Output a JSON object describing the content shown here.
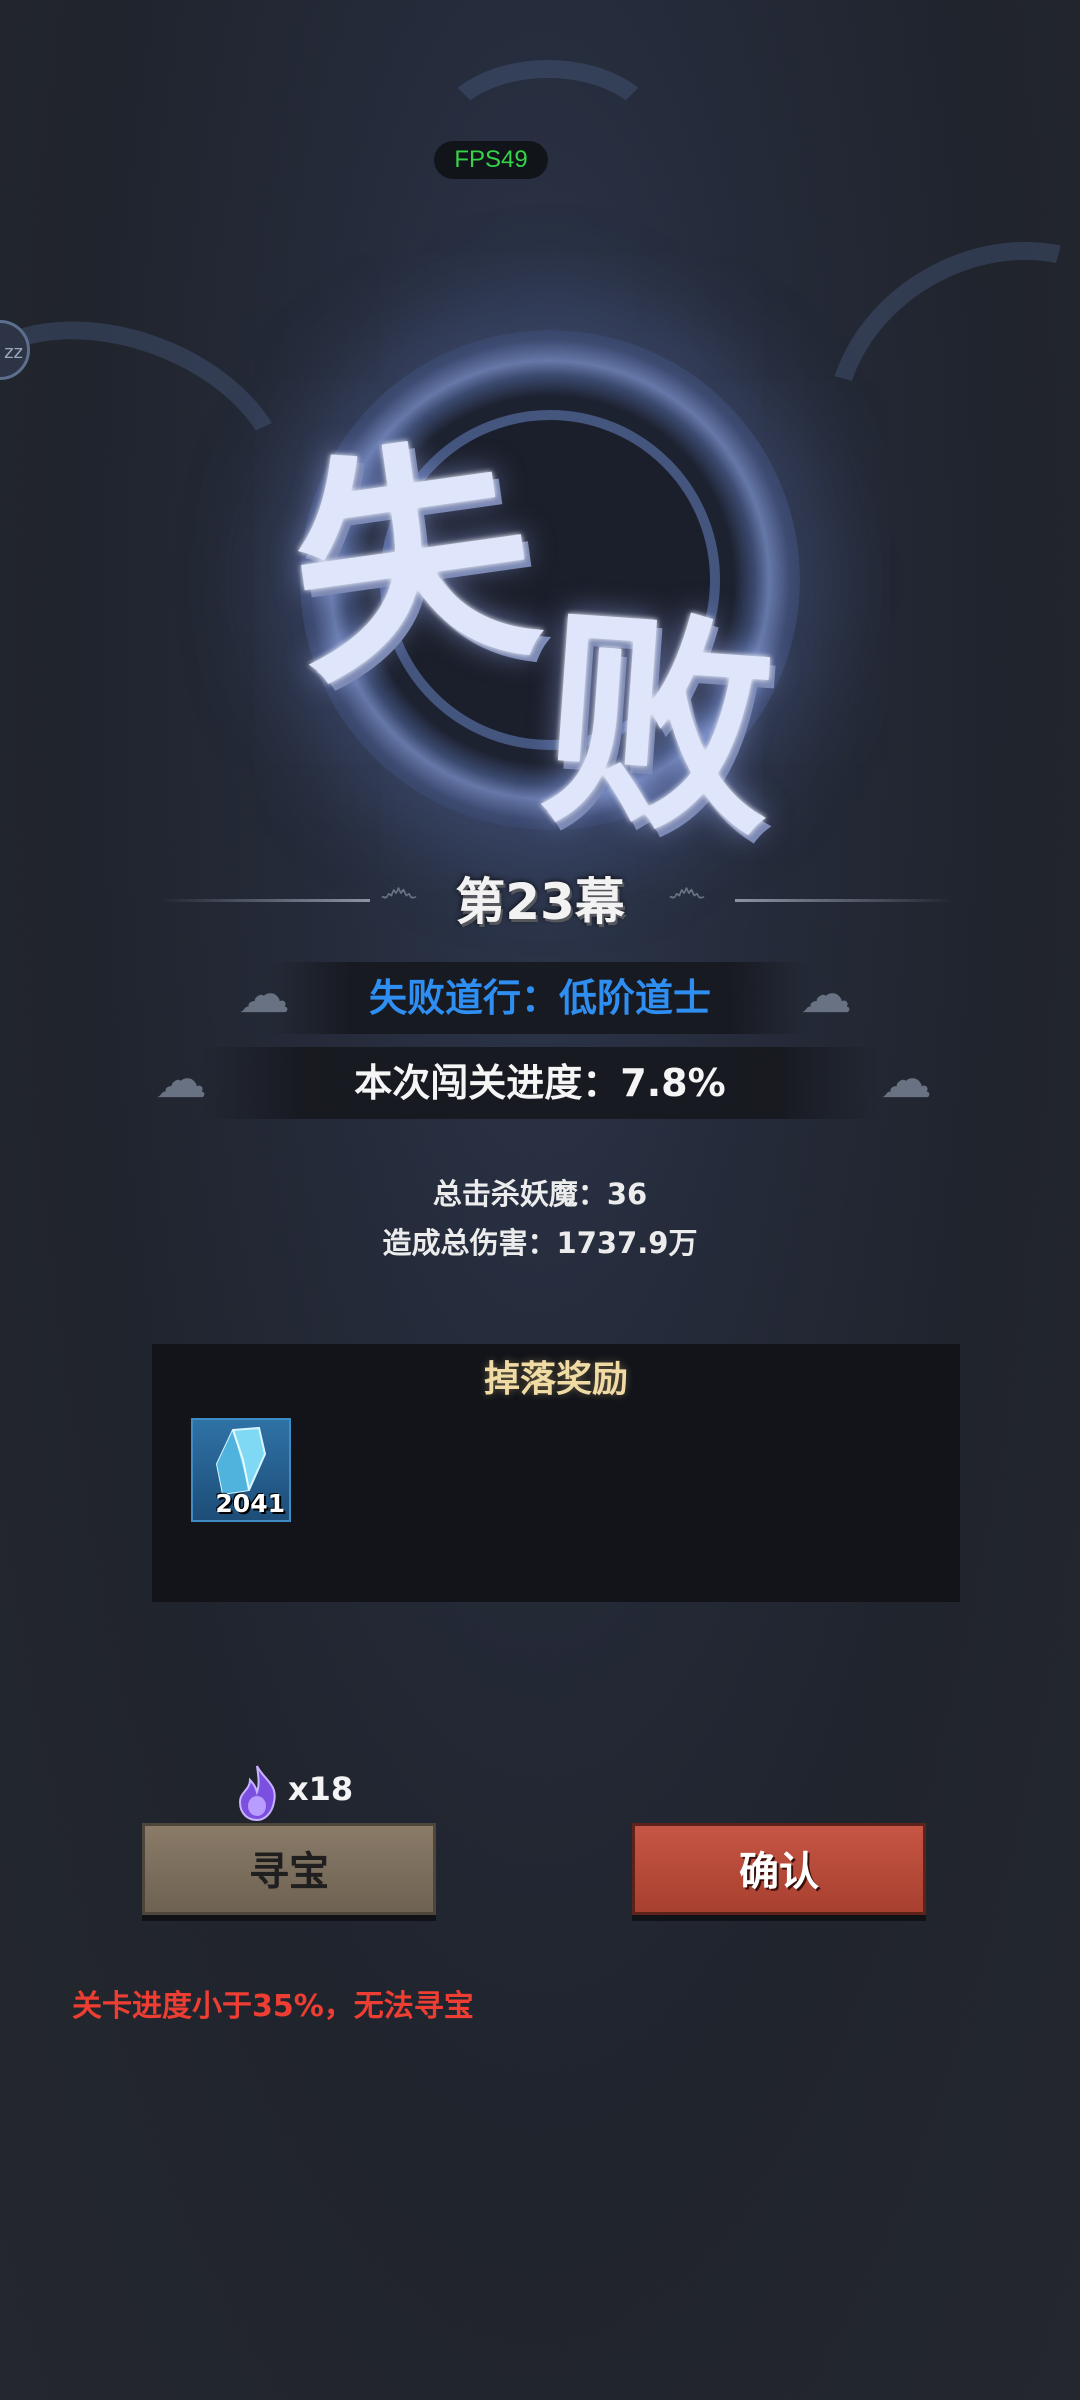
{
  "hud": {
    "fps": "FPS49",
    "side_badge": "zz"
  },
  "result": {
    "title_char1": "失",
    "title_char2": "败",
    "stage": "第23幕"
  },
  "summary": {
    "fail_rank": "失败道行：低阶道士",
    "progress": "本次闯关进度：7.8%",
    "kills": "总击杀妖魔：36",
    "damage": "造成总伤害：1737.9万"
  },
  "rewards": {
    "title": "掉落奖励",
    "items": [
      {
        "icon": "blue-crystal-icon",
        "count": "2041"
      }
    ]
  },
  "actions": {
    "ticket_count": "x18",
    "treasure_label": "寻宝",
    "confirm_label": "确认",
    "warning": "关卡进度小于35%，无法寻宝"
  },
  "colors": {
    "fail_rank": "#2e8ef2",
    "warning": "#ee3d32",
    "confirm": "#c65545",
    "treasure": "#8a7b68",
    "fps": "#35d24a"
  }
}
